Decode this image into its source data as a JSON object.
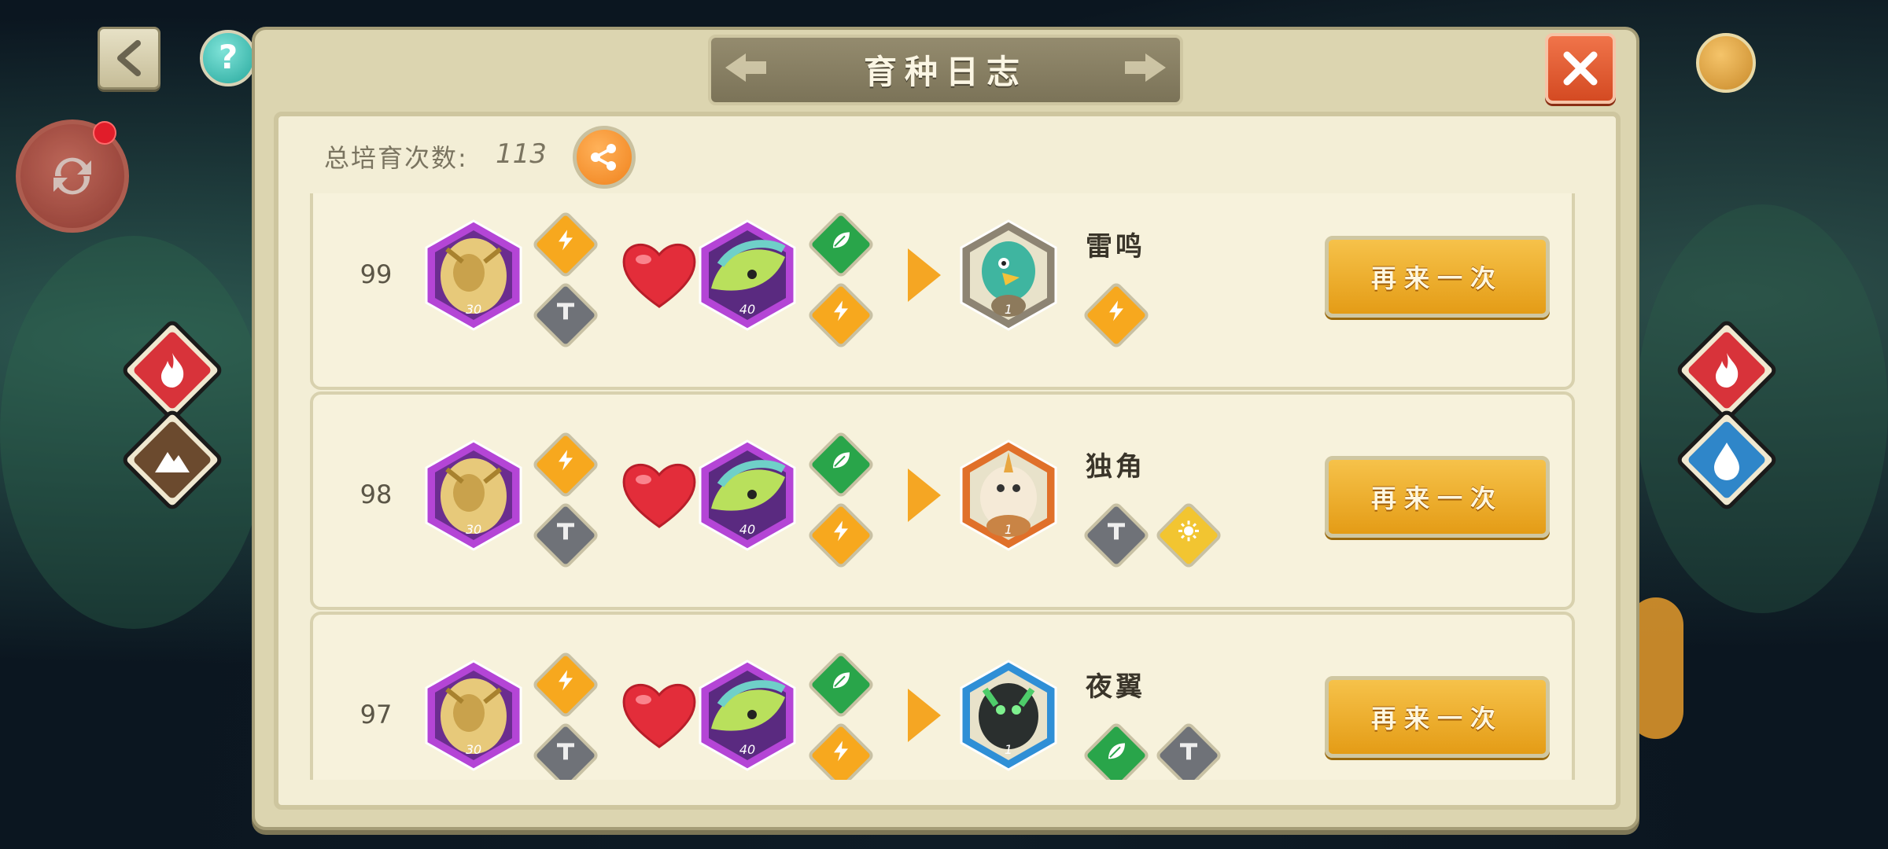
{
  "title": "育种日志",
  "total": {
    "label": "总培育次数:",
    "value": "113"
  },
  "again_label": "再来一次",
  "left_elements": [
    {
      "name": "fire-element-icon",
      "color": "#d8333a"
    },
    {
      "name": "mountain-element-icon",
      "color": "#6b4a2e"
    }
  ],
  "right_elements": [
    {
      "name": "fire-element-icon",
      "color": "#d8333a"
    },
    {
      "name": "water-element-icon",
      "color": "#2f86c9"
    }
  ],
  "records": [
    {
      "num": "99",
      "parent1": {
        "level": "30",
        "traits": [
          "electric",
          "metal"
        ]
      },
      "parent2": {
        "level": "40",
        "traits": [
          "grass",
          "electric"
        ]
      },
      "child": {
        "name": "雷鸣",
        "level": "1",
        "frame": "#8d8473",
        "traits": [
          "electric"
        ]
      }
    },
    {
      "num": "98",
      "parent1": {
        "level": "30",
        "traits": [
          "electric",
          "metal"
        ]
      },
      "parent2": {
        "level": "40",
        "traits": [
          "grass",
          "electric"
        ]
      },
      "child": {
        "name": "独角",
        "level": "1",
        "frame": "#e0702a",
        "traits": [
          "metal",
          "light"
        ]
      }
    },
    {
      "num": "97",
      "parent1": {
        "level": "30",
        "traits": [
          "electric",
          "metal"
        ]
      },
      "parent2": {
        "level": "40",
        "traits": [
          "grass",
          "electric"
        ]
      },
      "child": {
        "name": "夜翼",
        "level": "1",
        "frame": "#2f8fd6",
        "traits": [
          "grass",
          "metal"
        ]
      }
    }
  ]
}
